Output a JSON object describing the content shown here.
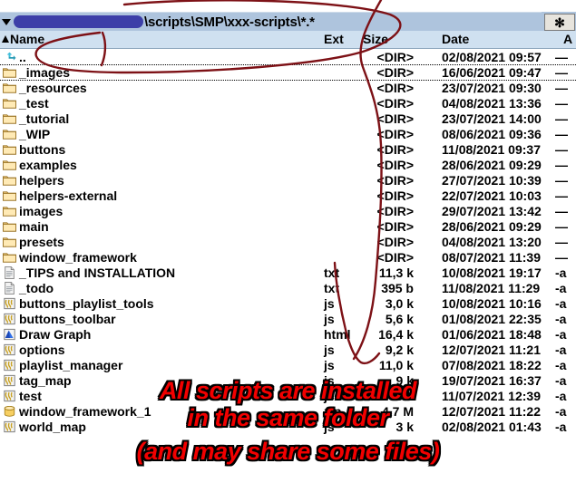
{
  "window": {
    "title_bar_color": "#aec4dd",
    "header_color": "#cfe0f0",
    "annotation_color": "#f20000",
    "curve_color": "#7d1116",
    "redaction_color": "#3d3fa8"
  },
  "pathbar": {
    "dropdown_icon": "chevron-down-icon",
    "redacted_prefix": "",
    "path": "\\scripts\\SMP\\xxx-scripts\\*.*",
    "star_button_label": "✻"
  },
  "columns": {
    "name": "Name",
    "ext": "Ext",
    "size": "Size",
    "date": "Date",
    "attr": "A",
    "sort_indicator": "ascending"
  },
  "rows": [
    {
      "icon": "parent-folder-icon",
      "name": "..",
      "ext": "",
      "size": "<DIR>",
      "date": "02/08/2021 09:57",
      "attr": "—"
    },
    {
      "icon": "folder-icon",
      "name": "_images",
      "ext": "",
      "size": "<DIR>",
      "date": "16/06/2021 09:47",
      "attr": "—"
    },
    {
      "icon": "folder-icon",
      "name": "_resources",
      "ext": "",
      "size": "<DIR>",
      "date": "23/07/2021 09:30",
      "attr": "—"
    },
    {
      "icon": "folder-icon",
      "name": "_test",
      "ext": "",
      "size": "<DIR>",
      "date": "04/08/2021 13:36",
      "attr": "—"
    },
    {
      "icon": "folder-icon",
      "name": "_tutorial",
      "ext": "",
      "size": "<DIR>",
      "date": "23/07/2021 14:00",
      "attr": "—"
    },
    {
      "icon": "folder-icon",
      "name": "_WIP",
      "ext": "",
      "size": "<DIR>",
      "date": "08/06/2021 09:36",
      "attr": "—"
    },
    {
      "icon": "folder-icon",
      "name": "buttons",
      "ext": "",
      "size": "<DIR>",
      "date": "11/08/2021 09:37",
      "attr": "—"
    },
    {
      "icon": "folder-icon",
      "name": "examples",
      "ext": "",
      "size": "<DIR>",
      "date": "28/06/2021 09:29",
      "attr": "—"
    },
    {
      "icon": "folder-icon",
      "name": "helpers",
      "ext": "",
      "size": "<DIR>",
      "date": "27/07/2021 10:39",
      "attr": "—"
    },
    {
      "icon": "folder-icon",
      "name": "helpers-external",
      "ext": "",
      "size": "<DIR>",
      "date": "22/07/2021 10:03",
      "attr": "—"
    },
    {
      "icon": "folder-icon",
      "name": "images",
      "ext": "",
      "size": "<DIR>",
      "date": "29/07/2021 13:42",
      "attr": "—"
    },
    {
      "icon": "folder-icon",
      "name": "main",
      "ext": "",
      "size": "<DIR>",
      "date": "28/06/2021 09:29",
      "attr": "—"
    },
    {
      "icon": "folder-icon",
      "name": "presets",
      "ext": "",
      "size": "<DIR>",
      "date": "04/08/2021 13:20",
      "attr": "—"
    },
    {
      "icon": "folder-icon",
      "name": "window_framework",
      "ext": "",
      "size": "<DIR>",
      "date": "08/07/2021 11:39",
      "attr": "—"
    },
    {
      "icon": "text-file-icon",
      "name": "_TIPS and INSTALLATION",
      "ext": "txt",
      "size": "11,3 k",
      "date": "10/08/2021 19:17",
      "attr": "-a"
    },
    {
      "icon": "text-file-icon",
      "name": "_todo",
      "ext": "txt",
      "size": "395 b",
      "date": "11/08/2021 11:29",
      "attr": "-a"
    },
    {
      "icon": "script-file-icon",
      "name": "buttons_playlist_tools",
      "ext": "js",
      "size": "3,0 k",
      "date": "10/08/2021 10:16",
      "attr": "-a"
    },
    {
      "icon": "script-file-icon",
      "name": "buttons_toolbar",
      "ext": "js",
      "size": "5,6 k",
      "date": "01/08/2021 22:35",
      "attr": "-a"
    },
    {
      "icon": "html-file-icon",
      "name": "Draw Graph",
      "ext": "html",
      "size": "16,4 k",
      "date": "01/06/2021 18:48",
      "attr": "-a"
    },
    {
      "icon": "script-file-icon",
      "name": "options",
      "ext": "js",
      "size": "9,2 k",
      "date": "12/07/2021 11:21",
      "attr": "-a"
    },
    {
      "icon": "script-file-icon",
      "name": "playlist_manager",
      "ext": "js",
      "size": "11,0 k",
      "date": "07/08/2021 18:22",
      "attr": "-a"
    },
    {
      "icon": "script-file-icon",
      "name": "tag_map",
      "ext": "js",
      "size": "9 k",
      "date": "19/07/2021 16:37",
      "attr": "-a"
    },
    {
      "icon": "script-file-icon",
      "name": "test",
      "ext": "js",
      "size": "5 k",
      "date": "11/07/2021 12:39",
      "attr": "-a"
    },
    {
      "icon": "archive-file-icon",
      "name": "window_framework_1",
      "ext": "zip",
      "size": "4,7 M",
      "date": "12/07/2021 11:22",
      "attr": "-a"
    },
    {
      "icon": "script-file-icon",
      "name": "world_map",
      "ext": "js",
      "size": "3 k",
      "date": "02/08/2021 01:43",
      "attr": "-a"
    }
  ],
  "annotations": {
    "line1": "All scripts are installed",
    "line2": "in the same folder",
    "line3": "(and may share some files)"
  }
}
